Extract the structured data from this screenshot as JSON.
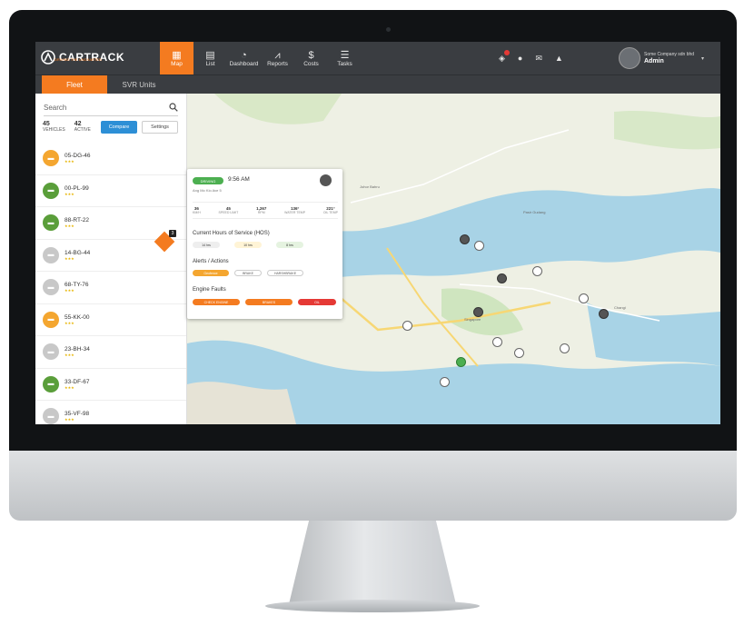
{
  "app": {
    "brand": "CARTRACK",
    "tagline": "DRIVING THE UNCHARTED",
    "nav": [
      {
        "label": "Map",
        "icon": "map-icon",
        "glyph": "▦",
        "active": true
      },
      {
        "label": "List",
        "icon": "list-icon",
        "glyph": "▤",
        "active": false
      },
      {
        "label": "Dashboard",
        "icon": "dashboard-icon",
        "glyph": "◔",
        "active": false
      },
      {
        "label": "Reports",
        "icon": "reports-icon",
        "glyph": "⩘",
        "active": false
      },
      {
        "label": "Costs",
        "icon": "costs-icon",
        "glyph": "$",
        "active": false
      },
      {
        "label": "Tasks",
        "icon": "tasks-icon",
        "glyph": "☰",
        "active": false
      }
    ],
    "user": {
      "company": "Some Company sdn bhd",
      "name": "Admin"
    }
  },
  "tabs": {
    "fleet": "Fleet",
    "svr": "SVR Units"
  },
  "sidebar": {
    "search_placeholder": "Search",
    "counts": [
      {
        "value": "45",
        "label": "VEHICLES"
      },
      {
        "value": "42",
        "label": "ACTIVE"
      }
    ],
    "compare_label": "Compare",
    "settings_label": "Settings",
    "vehicles": [
      {
        "plate": "05-DG-46",
        "color": "#f4a630"
      },
      {
        "plate": "00-PL-99",
        "color": "#5a9e3a"
      },
      {
        "plate": "88-RT-22",
        "color": "#5a9e3a"
      },
      {
        "plate": "14-BG-44",
        "color": "#c8c8c8"
      },
      {
        "plate": "68-TY-76",
        "color": "#c8c8c8"
      },
      {
        "plate": "55-KK-00",
        "color": "#f4a630"
      },
      {
        "plate": "23-BH-34",
        "color": "#c8c8c8"
      },
      {
        "plate": "33-DF-67",
        "color": "#5a9e3a"
      },
      {
        "plate": "35-VF-98",
        "color": "#c8c8c8"
      }
    ],
    "marker_count": "3"
  },
  "popup": {
    "status": "DRIVING",
    "time": "9:56 AM",
    "subtitle": "Ang Mo Kio Ave 5",
    "stats": [
      {
        "value": "36",
        "label": "KM/H"
      },
      {
        "value": "45",
        "label": "SPEED LIMIT"
      },
      {
        "value": "1,267",
        "label": "RPM"
      },
      {
        "value": "136°",
        "label": "WATER TEMP"
      },
      {
        "value": "221°",
        "label": "OIL TEMP"
      }
    ],
    "hos_title": "Current Hours of Service (HOS)",
    "hos_items": [
      "14 hrs",
      "10 hrs",
      "8 hrs"
    ],
    "alerts_title": "Alerts / Actions",
    "alerts": [
      "Geofence",
      "BRAKE",
      "HARSHBRAKE"
    ],
    "engine_title": "Engine Faults",
    "faults": [
      "CHECK ENGINE",
      "BRAKES",
      "OIL"
    ]
  },
  "map": {
    "labels": [
      "Johor Bahru",
      "Singapore",
      "Pasir Gudang",
      "Changi"
    ]
  }
}
